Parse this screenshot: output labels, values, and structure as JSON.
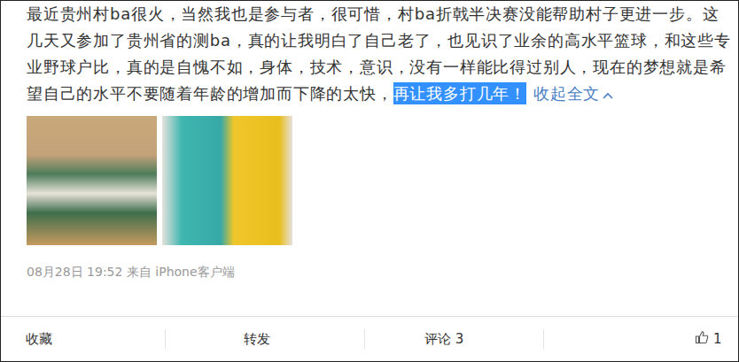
{
  "post": {
    "lines": [
      "最近贵州村ba很火，当然我也是参与者，很可惜，村ba折戟半决赛没能帮助村子更进一步。这",
      "几天又参加了贵州省的测ba，真的让我明白了自己老了，也见识了业余的高水平篮球，和这些专",
      "业野球户比，真的是自愧不如，身体，技术，意识，没有一样能比得过别人，现在的梦想就是希"
    ],
    "last_line": "望自己的水平不要随着年龄的增加而下降的太快，",
    "selection": {
      "text": "再让我多打几年！",
      "selected": true
    },
    "collapse": "收起全文"
  },
  "meta": "08月28日 19:52  来自 iPhone客户端",
  "actions": [
    {
      "label": "收藏",
      "kind": "text"
    },
    {
      "label": "转发",
      "kind": "text"
    },
    {
      "label": "评论 3",
      "kind": "text"
    },
    {
      "label": "1",
      "kind": "like"
    }
  ]
}
